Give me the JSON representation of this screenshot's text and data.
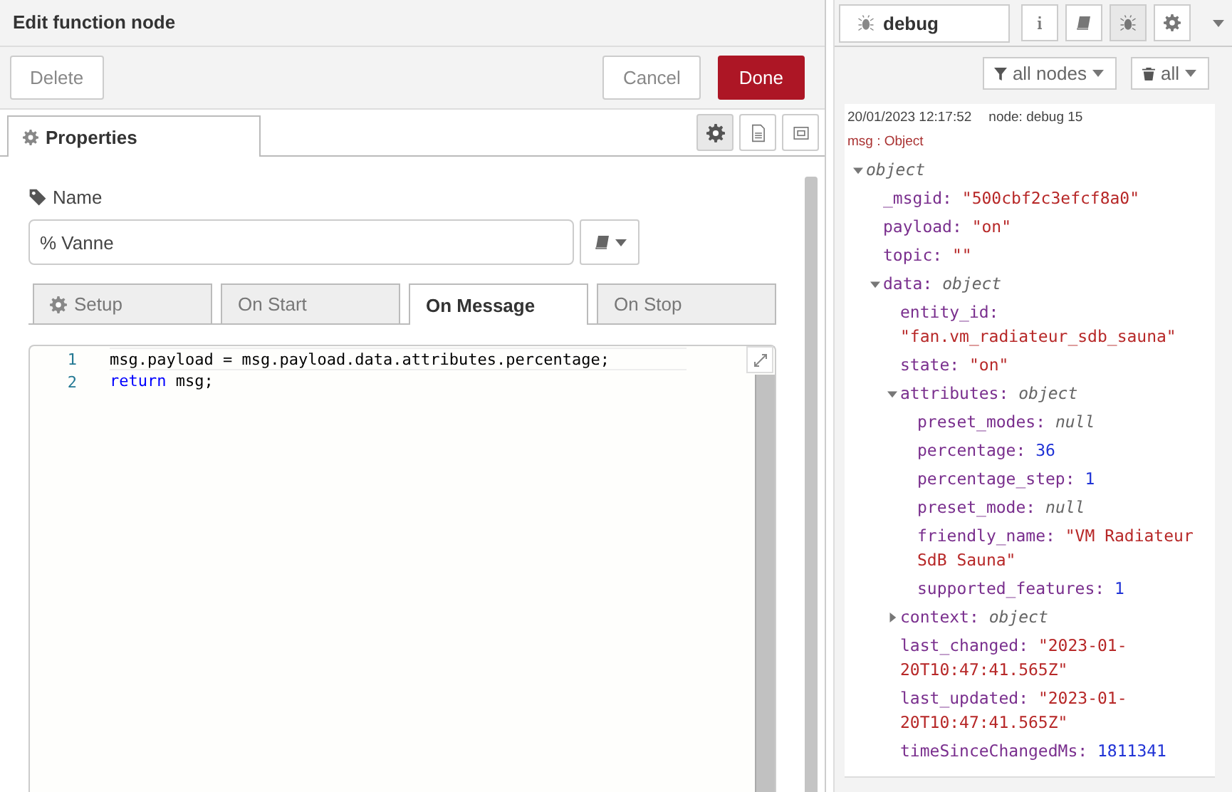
{
  "editor": {
    "title": "Edit function node",
    "buttons": [
      {
        "label": "Delete",
        "kind": "plain"
      },
      {
        "label": "Cancel",
        "kind": "plain"
      },
      {
        "label": "Done",
        "kind": "primary"
      }
    ],
    "tab": {
      "label": "Properties",
      "selected": true
    },
    "toolbar": [
      {
        "selected": true
      },
      {
        "selected": false
      },
      {
        "selected": false
      }
    ],
    "name_label": "Name",
    "name_value": "% Vanne",
    "code_tabs": [
      {
        "label": "Setup",
        "selected": false
      },
      {
        "label": "On Start",
        "selected": false
      },
      {
        "label": "On Message",
        "selected": true
      },
      {
        "label": "On Stop",
        "selected": false
      }
    ],
    "code_lines": [
      {
        "number": "1",
        "current": true,
        "tokens": [
          {
            "text": "msg.payload = msg.payload.data.attributes.percentage;",
            "kind": "plain"
          }
        ]
      },
      {
        "number": "2",
        "current": false,
        "tokens": [
          {
            "text": "return",
            "kind": "keyword"
          },
          {
            "text": " msg;",
            "kind": "plain"
          }
        ]
      }
    ]
  },
  "sidebar": {
    "tab": {
      "label": "debug",
      "selected": true
    },
    "tools": [
      {
        "selected": false
      },
      {
        "selected": false
      },
      {
        "selected": true
      },
      {
        "selected": false
      }
    ],
    "filter": "all nodes",
    "clear": "all",
    "message": {
      "time": "20/01/2023 12:17:52",
      "node": "node: debug 15",
      "type": "msg : Object",
      "tree": {
        "value": "object",
        "kind": "object",
        "expanded": true,
        "children": [
          {
            "key": "_msgid:",
            "value": "\"500cbf2c3efcf8a0\"",
            "kind": "string"
          },
          {
            "key": "payload:",
            "value": "\"on\"",
            "kind": "string"
          },
          {
            "key": "topic:",
            "value": "\"\"",
            "kind": "string"
          },
          {
            "key": "data:",
            "value": "object",
            "kind": "object",
            "expanded": true,
            "children": [
              {
                "key": "entity_id:",
                "value": "\"fan.vm_radiateur_sdb_sauna\"",
                "kind": "string"
              },
              {
                "key": "state:",
                "value": "\"on\"",
                "kind": "string"
              },
              {
                "key": "attributes:",
                "value": "object",
                "kind": "object",
                "expanded": true,
                "children": [
                  {
                    "key": "preset_modes:",
                    "value": "null",
                    "kind": "null"
                  },
                  {
                    "key": "percentage:",
                    "value": "36",
                    "kind": "number"
                  },
                  {
                    "key": "percentage_step:",
                    "value": "1",
                    "kind": "number"
                  },
                  {
                    "key": "preset_mode:",
                    "value": "null",
                    "kind": "null"
                  },
                  {
                    "key": "friendly_name:",
                    "value": "\"VM Radiateur SdB Sauna\"",
                    "kind": "string"
                  },
                  {
                    "key": "supported_features:",
                    "value": "1",
                    "kind": "number"
                  }
                ]
              },
              {
                "key": "context:",
                "value": "object",
                "kind": "object",
                "expanded": false
              },
              {
                "key": "last_changed:",
                "value": "\"2023-01-20T10:47:41.565Z\"",
                "kind": "string"
              },
              {
                "key": "last_updated:",
                "value": "\"2023-01-20T10:47:41.565Z\"",
                "kind": "string"
              },
              {
                "key": "timeSinceChangedMs:",
                "value": "1811341",
                "kind": "number"
              }
            ]
          }
        ]
      }
    }
  }
}
